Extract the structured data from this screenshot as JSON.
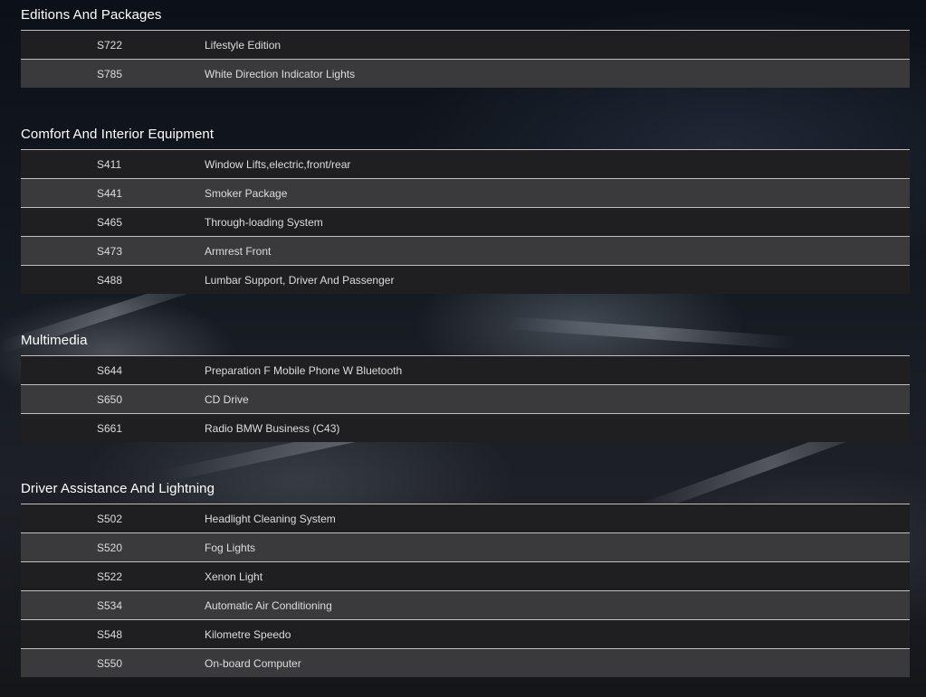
{
  "sections": [
    {
      "title": "Editions And Packages",
      "rows": [
        {
          "code": "S722",
          "desc": "Lifestyle Edition"
        },
        {
          "code": "S785",
          "desc": "White Direction Indicator Lights"
        }
      ]
    },
    {
      "title": "Comfort And Interior Equipment",
      "rows": [
        {
          "code": "S411",
          "desc": "Window Lifts,electric,front/rear"
        },
        {
          "code": "S441",
          "desc": "Smoker Package"
        },
        {
          "code": "S465",
          "desc": "Through-loading System"
        },
        {
          "code": "S473",
          "desc": "Armrest Front"
        },
        {
          "code": "S488",
          "desc": "Lumbar Support, Driver And Passenger"
        }
      ]
    },
    {
      "title": "Multimedia",
      "rows": [
        {
          "code": "S644",
          "desc": "Preparation F Mobile Phone W Bluetooth"
        },
        {
          "code": "S650",
          "desc": "CD Drive"
        },
        {
          "code": "S661",
          "desc": "Radio BMW Business (C43)"
        }
      ]
    },
    {
      "title": "Driver Assistance And Lightning",
      "rows": [
        {
          "code": "S502",
          "desc": "Headlight Cleaning System"
        },
        {
          "code": "S520",
          "desc": "Fog Lights"
        },
        {
          "code": "S522",
          "desc": "Xenon Light"
        },
        {
          "code": "S534",
          "desc": "Automatic Air Conditioning"
        },
        {
          "code": "S548",
          "desc": "Kilometre Speedo"
        },
        {
          "code": "S550",
          "desc": "On-board Computer"
        }
      ]
    }
  ]
}
